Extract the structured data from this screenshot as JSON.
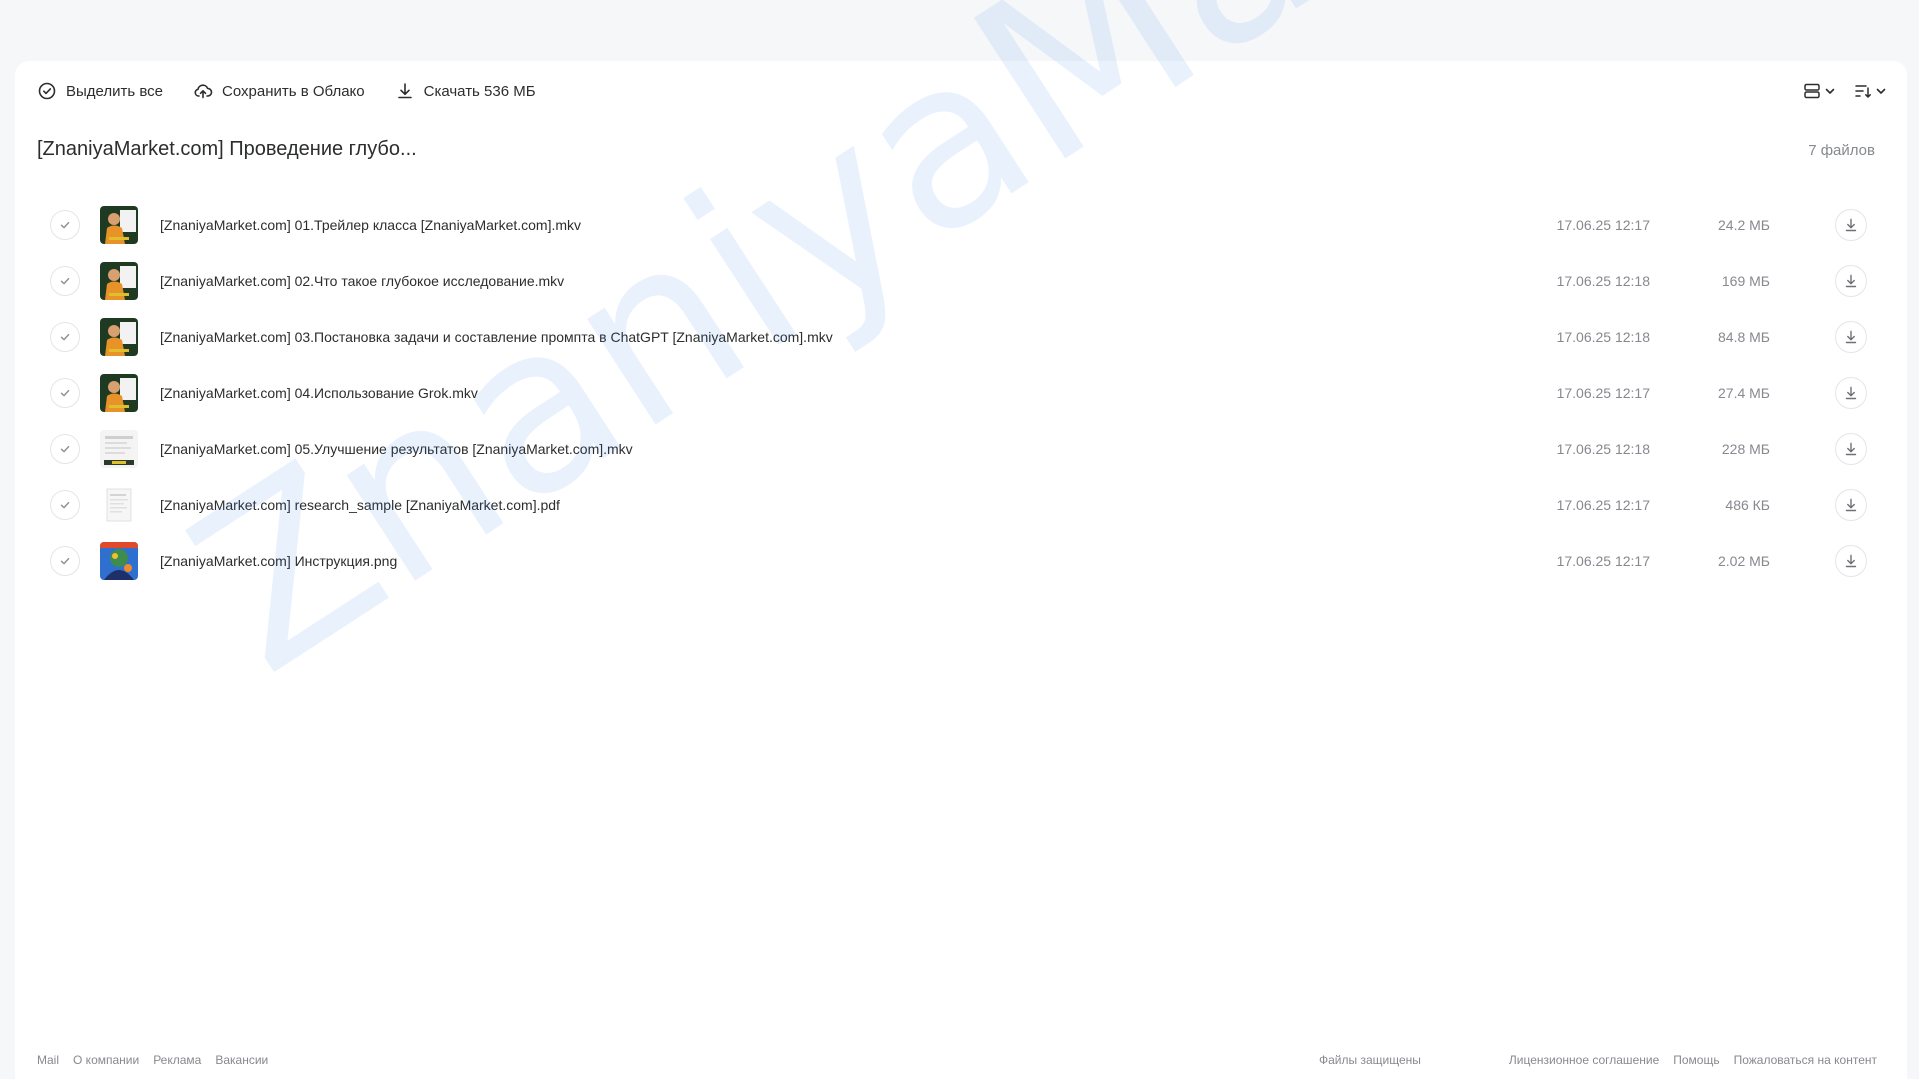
{
  "toolbar": {
    "select_all": "Выделить все",
    "save_cloud": "Сохранить в Облако",
    "download": "Скачать 536 МБ"
  },
  "folder": {
    "title": "[ZnaniyaMarket.com] Проведение глубо...",
    "count": "7 файлов"
  },
  "files": [
    {
      "name": "[ZnaniyaMarket.com] 01.Трейлер класса [ZnaniyaMarket.com].mkv",
      "date": "17.06.25 12:17",
      "size": "24.2 МБ",
      "thumb": "video"
    },
    {
      "name": "[ZnaniyaMarket.com] 02.Что такое глубокое исследование.mkv",
      "date": "17.06.25 12:18",
      "size": "169 МБ",
      "thumb": "video"
    },
    {
      "name": "[ZnaniyaMarket.com] 03.Постановка задачи и составление промпта в ChatGPT [ZnaniyaMarket.com].mkv",
      "date": "17.06.25 12:18",
      "size": "84.8 МБ",
      "thumb": "video"
    },
    {
      "name": "[ZnaniyaMarket.com] 04.Использование Grok.mkv",
      "date": "17.06.25 12:17",
      "size": "27.4 МБ",
      "thumb": "video"
    },
    {
      "name": "[ZnaniyaMarket.com] 05.Улучшение результатов [ZnaniyaMarket.com].mkv",
      "date": "17.06.25 12:18",
      "size": "228 МБ",
      "thumb": "doc-video"
    },
    {
      "name": "[ZnaniyaMarket.com] research_sample [ZnaniyaMarket.com].pdf",
      "date": "17.06.25 12:17",
      "size": "486 КБ",
      "thumb": "pdf"
    },
    {
      "name": "[ZnaniyaMarket.com] Инструкция.png",
      "date": "17.06.25 12:17",
      "size": "2.02 МБ",
      "thumb": "image"
    }
  ],
  "footer": {
    "mail": "Mail",
    "about": "О компании",
    "ads": "Реклама",
    "jobs": "Вакансии",
    "protected": "Файлы защищены",
    "license": "Лицензионное соглашение",
    "help": "Помощь",
    "report": "Пожаловаться на контент"
  },
  "watermark": "ZnaniyaMarket.club",
  "colors": {
    "background": "#f6f7f9",
    "panel": "#ffffff",
    "text": "#2c2d2e",
    "secondary": "#87898f",
    "border": "#e4e5e8",
    "watermark": "#1a73e8"
  },
  "icons": {
    "select_all": "check-circle-icon",
    "save_cloud": "cloud-upload-icon",
    "download": "download-icon",
    "view": "view-mode-icon",
    "sort": "sort-icon"
  }
}
